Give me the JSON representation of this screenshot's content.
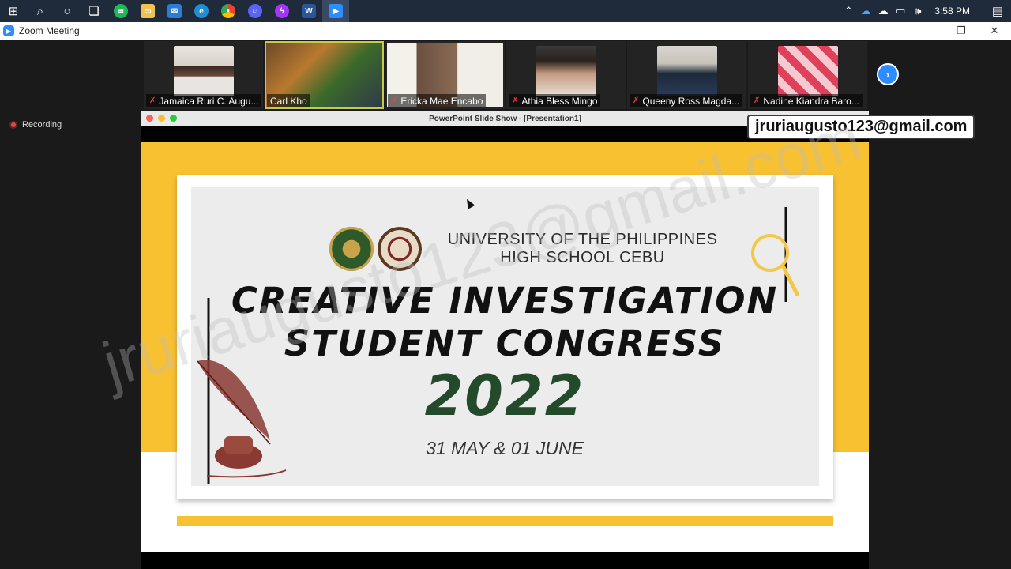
{
  "taskbar": {
    "time": "3:58 PM",
    "apps": [
      "spotify-icon",
      "file-explorer-icon",
      "mail-icon",
      "edge-icon",
      "chrome-icon",
      "discord-icon",
      "messenger-icon",
      "word-icon",
      "zoom-icon"
    ]
  },
  "window": {
    "title": "Zoom Meeting",
    "minimize": "—",
    "restore": "❐",
    "close": "✕"
  },
  "recording": {
    "label": "Recording"
  },
  "participants": [
    {
      "name": "Jamaica Ruri C. Augu..."
    },
    {
      "name": "Carl Kho"
    },
    {
      "name": "Ericka Mae Encabo"
    },
    {
      "name": "Athia Bless Mingo"
    },
    {
      "name": "Queeny Ross Magda..."
    },
    {
      "name": "Nadine Kiandra Baro..."
    }
  ],
  "share": {
    "title": "PowerPoint Slide Show - [Presentation1]",
    "email": "jruriaugusto123@gmail.com",
    "watermark": "jruriaugusto123@gmail.com"
  },
  "slide": {
    "university_line1": "UNIVERSITY OF THE PHILIPPINES",
    "university_line2": "HIGH SCHOOL CEBU",
    "title_line1": "CREATIVE INVESTIGATION",
    "title_line2": "STUDENT CONGRESS",
    "year": "2022",
    "date": "31 MAY & 01 JUNE"
  },
  "colors": {
    "slide_yellow": "#f7c131",
    "year_green": "#234a2a",
    "zoom_blue": "#2d8cff",
    "recording_red": "#e8453c"
  }
}
